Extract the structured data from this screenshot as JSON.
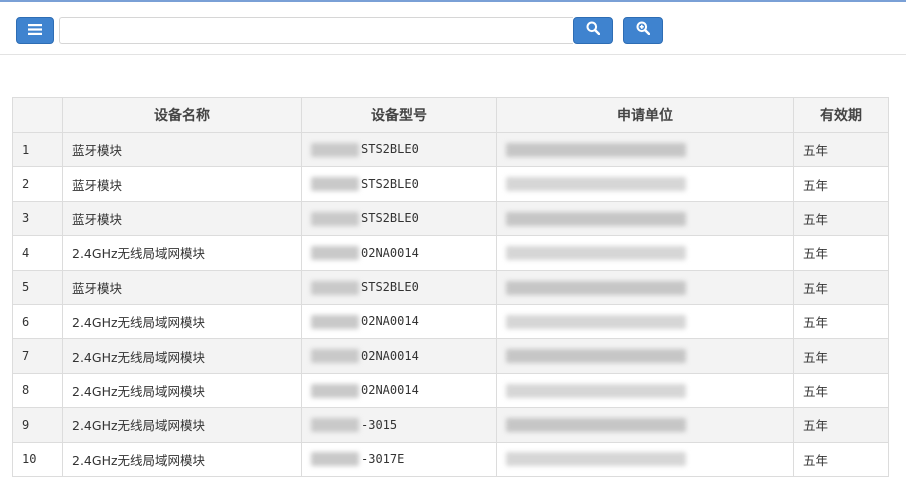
{
  "toolbar": {
    "menu_icon": "menu-icon",
    "search_value": "",
    "search_icon": "search-icon",
    "zoom_icon": "zoom-in-icon",
    "accent_color": "#3f83cf"
  },
  "table": {
    "columns": [
      "",
      "设备名称",
      "设备型号",
      "申请单位",
      "有效期"
    ],
    "rows": [
      {
        "index": "1",
        "name": "蓝牙模块",
        "model": "STS2BLE0",
        "period": "五年"
      },
      {
        "index": "2",
        "name": "蓝牙模块",
        "model": "STS2BLE0",
        "period": "五年"
      },
      {
        "index": "3",
        "name": "蓝牙模块",
        "model": "STS2BLE0",
        "period": "五年"
      },
      {
        "index": "4",
        "name": "2.4GHz无线局域网模块",
        "model": "02NA0014",
        "period": "五年"
      },
      {
        "index": "5",
        "name": "蓝牙模块",
        "model": "STS2BLE0",
        "period": "五年"
      },
      {
        "index": "6",
        "name": "2.4GHz无线局域网模块",
        "model": "02NA0014",
        "period": "五年"
      },
      {
        "index": "7",
        "name": "2.4GHz无线局域网模块",
        "model": "02NA0014",
        "period": "五年"
      },
      {
        "index": "8",
        "name": "2.4GHz无线局域网模块",
        "model": "02NA0014",
        "period": "五年"
      },
      {
        "index": "9",
        "name": "2.4GHz无线局域网模块",
        "model": "-3015",
        "period": "五年"
      },
      {
        "index": "10",
        "name": "2.4GHz无线局域网模块",
        "model": "-3017E",
        "period": "五年"
      }
    ]
  }
}
